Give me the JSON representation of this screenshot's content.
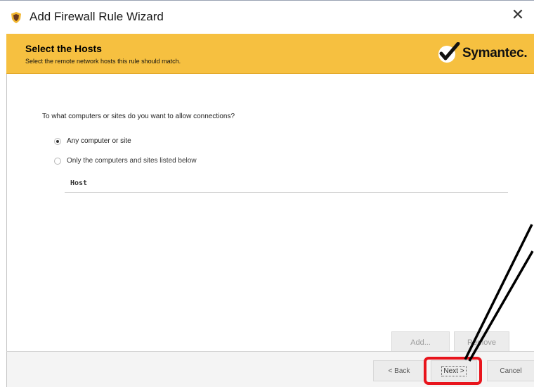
{
  "window": {
    "title": "Add Firewall Rule Wizard",
    "close_glyph": "✕"
  },
  "banner": {
    "title": "Select the Hosts",
    "subtitle": "Select the remote network hosts this rule should match.",
    "logo_text": "Symantec.",
    "color": "#f6c040"
  },
  "main": {
    "question": "To what computers or sites do you want to allow connections?",
    "options": [
      {
        "label": "Any computer or site",
        "selected": true
      },
      {
        "label": "Only the computers and sites listed below",
        "selected": false
      }
    ],
    "table": {
      "columns": [
        "Host"
      ],
      "rows": []
    },
    "add_label": "Add...",
    "remove_label": "Remove"
  },
  "footer": {
    "back_label": "< Back",
    "next_label": "Next >",
    "cancel_label": "Cancel"
  },
  "annotation": {
    "highlight_color": "#e8141c",
    "arrow_color": "#000000"
  }
}
